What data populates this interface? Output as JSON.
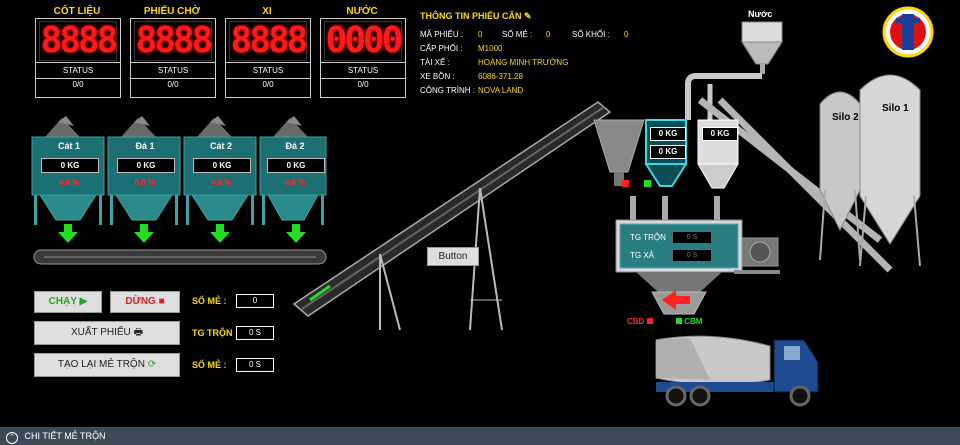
{
  "displays": [
    {
      "title": "CỐT LIỆU",
      "digits": "8888",
      "status": "STATUS",
      "count": "0/0"
    },
    {
      "title": "PHIẾU CHỜ",
      "digits": "8888",
      "status": "STATUS",
      "count": "0/0"
    },
    {
      "title": "XI",
      "digits": "8888",
      "status": "STATUS",
      "count": "0/0"
    },
    {
      "title": "NƯỚC",
      "digits": "0000",
      "status": "STATUS",
      "count": "0/0"
    }
  ],
  "ticket": {
    "title": "THÔNG TIN PHIẾU CÂN",
    "ma_phieu_label": "MÃ PHIẾU :",
    "ma_phieu_value": "0",
    "so_me_label": "SỐ MẺ :",
    "so_me_value": "0",
    "so_khoi_label": "SỐ KHỐI :",
    "so_khoi_value": "0",
    "cap_phoi_label": "CẤP PHỐI :",
    "cap_phoi_value": "M1000",
    "tai_xe_label": "TÀI XẾ :",
    "tai_xe_value": "HOÀNG MINH TRƯỜNG",
    "xe_bon_label": "XE BỒN :",
    "xe_bon_value": "6086-371.28",
    "cong_trinh_label": "CÔNG TRÌNH :",
    "cong_trinh_value": "NOVA LAND"
  },
  "hoppers": [
    {
      "name": "Cát 1",
      "kg": "0 KG",
      "pct": "0.0 %"
    },
    {
      "name": "Đá 1",
      "kg": "0 KG",
      "pct": "0.0 %"
    },
    {
      "name": "Cát 2",
      "kg": "0 KG",
      "pct": "0.0 %"
    },
    {
      "name": "Đá 2",
      "kg": "0 KG",
      "pct": "0.0 %"
    }
  ],
  "controls": {
    "run_label": "CHẠY",
    "stop_label": "DỪNG",
    "export_label": "XUẤT PHIẾU",
    "recreate_label": "TẠO LẠI MẺ TRỘN",
    "so_me_label": "SỐ MẺ :",
    "so_me_value": "0",
    "tg_tron_label": "TG TRỘN :",
    "tg_tron_value": "0 S",
    "so_me2_label": "SỐ MẺ :",
    "so_me2_value": "0 S"
  },
  "generic_button": "Button",
  "plant": {
    "water_label": "Nước",
    "cement_kg_top": "0 KG",
    "cement_kg_bottom": "0 KG",
    "water_kg": "0 KG",
    "mixer_tg_tron_label": "TG TRỘN",
    "mixer_tg_tron_value": "0 S",
    "mixer_tg_xa_label": "TG XẢ",
    "mixer_tg_xa_value": "0 S",
    "cbd_label": "CBD",
    "cbm_label": "CBM",
    "silo2_label": "Silo 2",
    "silo1_label": "Silo 1"
  },
  "footer": {
    "label": "CHI TIẾT MẺ TRỘN"
  },
  "colors": {
    "accent_yellow": "#ffd800",
    "led_red": "#ff1a1a",
    "steel": "#3aa3a3",
    "arrow_green": "#22dd22",
    "truck_blue": "#1e4b8f"
  }
}
